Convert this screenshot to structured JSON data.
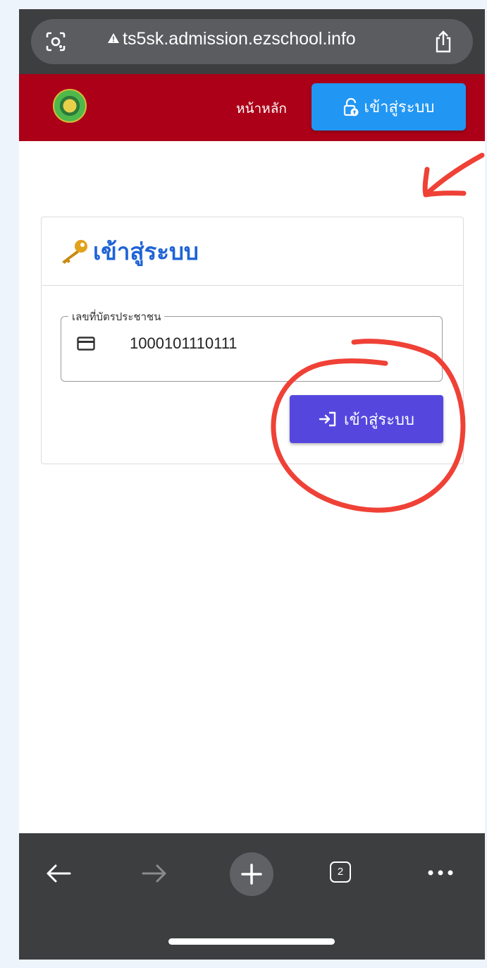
{
  "browser": {
    "url": "ts5sk.admission.ezschool.info",
    "tab_count": "2",
    "icons": [
      "lens-icon",
      "warning-icon",
      "share-icon",
      "back-arrow-icon",
      "forward-arrow-icon",
      "plus-icon",
      "tabs-icon",
      "more-icon"
    ]
  },
  "header": {
    "home_label": "หน้าหลัก",
    "login_label": "เข้าสู่ระบบ",
    "background_color": "#ab0018",
    "login_button_color": "#2196f3"
  },
  "login_card": {
    "title": "เข้าสู่ระบบ",
    "id_field": {
      "label": "เลขที่บัตรประชาชน",
      "value": "1000101110111"
    },
    "submit_label": "เข้าสู่ระบบ",
    "submit_color": "#5547de",
    "title_color": "#1e63d6"
  },
  "annotations": {
    "color": "#ef4136",
    "marks": [
      "arrow pointing to top login button",
      "circle around submit button"
    ]
  }
}
